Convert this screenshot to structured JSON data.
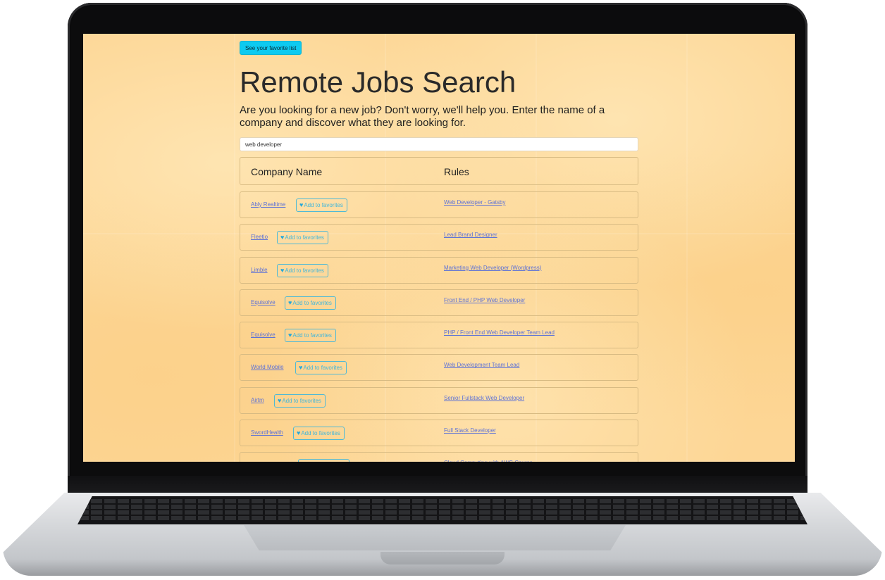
{
  "favorites_button": {
    "label": "See your favorite list"
  },
  "header": {
    "title": "Remote Jobs Search",
    "subtitle": "Are you looking for a new job? Don't worry, we'll help you. Enter the name of a company and discover what they are looking for."
  },
  "search": {
    "value": "web developer"
  },
  "table": {
    "columns": [
      "Company Name",
      "Rules"
    ],
    "add_label": "Add to favorites",
    "heart_icon": "heart-icon",
    "rows": [
      {
        "company": "Ably Realtime",
        "rule": "Web Developer - Gatsby"
      },
      {
        "company": "Fleetio",
        "rule": "Lead Brand Designer"
      },
      {
        "company": "Limble",
        "rule": "Marketing Web Developer (Wordpress)"
      },
      {
        "company": "Equisolve",
        "rule": "Front End / PHP Web Developer"
      },
      {
        "company": "Equisolve",
        "rule": "PHP / Front End Web Developer Team Lead"
      },
      {
        "company": "World Mobile",
        "rule": "Web Development Team Lead"
      },
      {
        "company": "Airtm",
        "rule": "Senior Fullstack Web Developer"
      },
      {
        "company": "SwordHealth",
        "rule": "Full Stack Developer"
      },
      {
        "company": "CareerFoundry",
        "rule": "Cloud Computing with AWS Course"
      }
    ]
  },
  "colors": {
    "page_background": "#fdd695",
    "favorites_button": "#0dcaf0",
    "link": "#5e72d6",
    "add_button": "#3fb6dc"
  }
}
